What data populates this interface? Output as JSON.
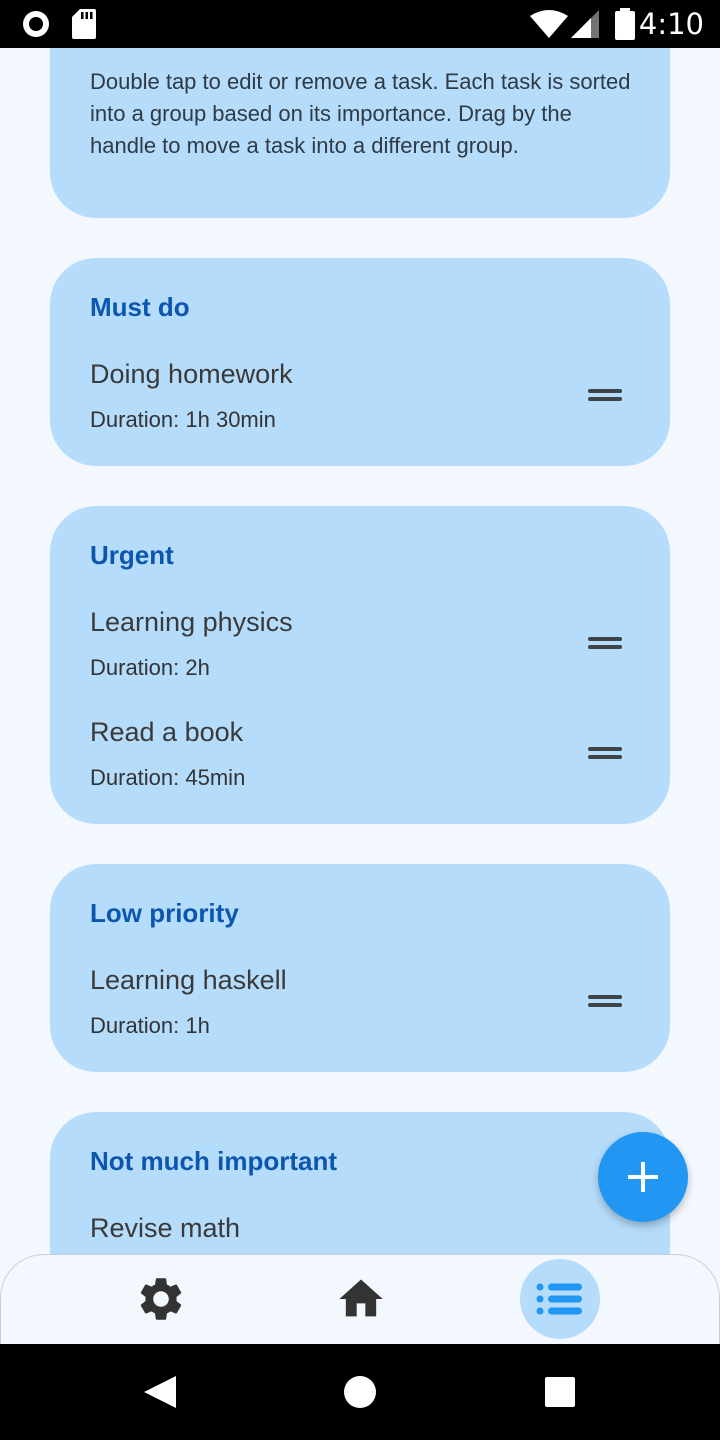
{
  "status_bar": {
    "time": "4:10",
    "icons": [
      "record-icon",
      "sd-card-icon",
      "wifi-icon",
      "cellular-signal-icon",
      "battery-icon"
    ]
  },
  "info": {
    "text": "Double tap to edit or remove a task. Each task is sorted into a group based on its importance. Drag by the handle to move a task into a different group."
  },
  "groups": [
    {
      "title": "Must do",
      "tasks": [
        {
          "name": "Doing homework",
          "duration": "Duration: 1h 30min"
        }
      ]
    },
    {
      "title": "Urgent",
      "tasks": [
        {
          "name": "Learning physics",
          "duration": "Duration: 2h"
        },
        {
          "name": "Read a book",
          "duration": "Duration: 45min"
        }
      ]
    },
    {
      "title": "Low priority",
      "tasks": [
        {
          "name": "Learning haskell",
          "duration": "Duration: 1h"
        }
      ]
    },
    {
      "title": "Not much important",
      "tasks": [
        {
          "name": "Revise math"
        }
      ]
    }
  ],
  "fab": {
    "icon": "plus-icon"
  },
  "bottom_nav": {
    "items": [
      {
        "icon": "gear-icon",
        "active": false
      },
      {
        "icon": "home-icon",
        "active": false
      },
      {
        "icon": "list-icon",
        "active": true
      }
    ]
  },
  "system_nav": {
    "icons": [
      "back-icon",
      "home-circle-icon",
      "recents-icon"
    ]
  },
  "colors": {
    "background": "#f3f8fe",
    "card": "#b5dcfb",
    "group_title": "#0d56b0",
    "accent": "#2196f3"
  }
}
